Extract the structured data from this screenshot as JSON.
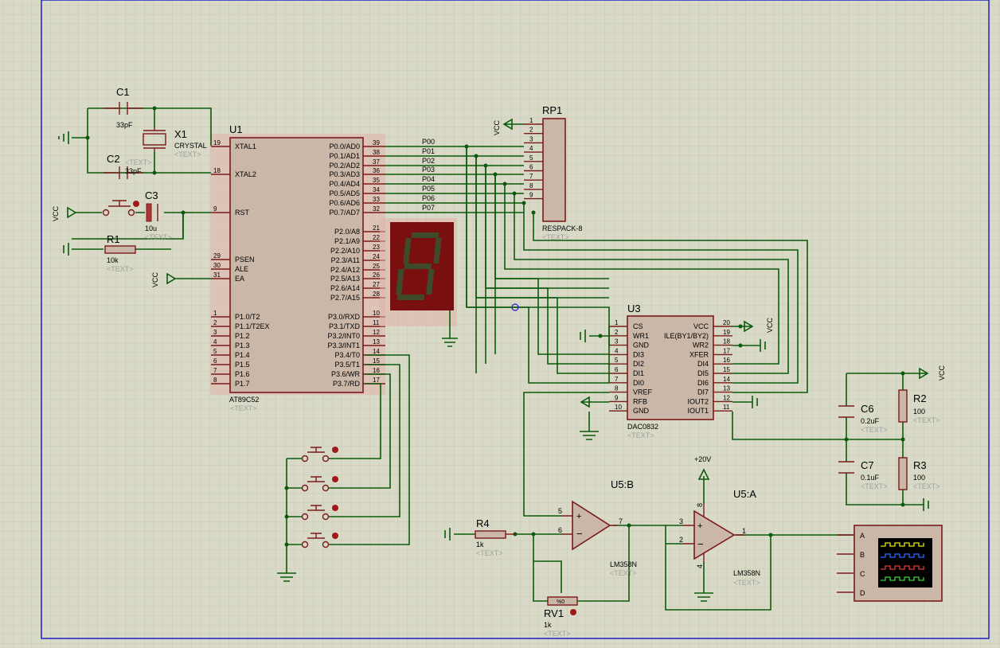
{
  "components": {
    "u1": {
      "ref": "U1",
      "part": "AT89C52",
      "text": "<TEXT>",
      "left_pins": [
        {
          "num": "19",
          "name": "XTAL1"
        },
        {
          "num": "18",
          "name": "XTAL2"
        },
        {
          "num": "9",
          "name": "RST"
        },
        {
          "num": "29",
          "name": "PSEN"
        },
        {
          "num": "30",
          "name": "ALE"
        },
        {
          "num": "31",
          "name": "EA"
        },
        {
          "num": "1",
          "name": "P1.0/T2"
        },
        {
          "num": "2",
          "name": "P1.1/T2EX"
        },
        {
          "num": "3",
          "name": "P1.2"
        },
        {
          "num": "4",
          "name": "P1.3"
        },
        {
          "num": "5",
          "name": "P1.4"
        },
        {
          "num": "6",
          "name": "P1.5"
        },
        {
          "num": "7",
          "name": "P1.6"
        },
        {
          "num": "8",
          "name": "P1.7"
        }
      ],
      "right_pins": [
        {
          "num": "39",
          "name": "P0.0/AD0"
        },
        {
          "num": "38",
          "name": "P0.1/AD1"
        },
        {
          "num": "37",
          "name": "P0.2/AD2"
        },
        {
          "num": "36",
          "name": "P0.3/AD3"
        },
        {
          "num": "35",
          "name": "P0.4/AD4"
        },
        {
          "num": "34",
          "name": "P0.5/AD5"
        },
        {
          "num": "33",
          "name": "P0.6/AD6"
        },
        {
          "num": "32",
          "name": "P0.7/AD7"
        },
        {
          "num": "21",
          "name": "P2.0/A8"
        },
        {
          "num": "22",
          "name": "P2.1/A9"
        },
        {
          "num": "23",
          "name": "P2.2/A10"
        },
        {
          "num": "24",
          "name": "P2.3/A11"
        },
        {
          "num": "25",
          "name": "P2.4/A12"
        },
        {
          "num": "26",
          "name": "P2.5/A13"
        },
        {
          "num": "27",
          "name": "P2.6/A14"
        },
        {
          "num": "28",
          "name": "P2.7/A15"
        },
        {
          "num": "10",
          "name": "P3.0/RXD"
        },
        {
          "num": "11",
          "name": "P3.1/TXD"
        },
        {
          "num": "12",
          "name": "P3.2/INT0"
        },
        {
          "num": "13",
          "name": "P3.3/INT1"
        },
        {
          "num": "14",
          "name": "P3.4/T0"
        },
        {
          "num": "15",
          "name": "P3.5/T1"
        },
        {
          "num": "16",
          "name": "P3.6/WR"
        },
        {
          "num": "17",
          "name": "P3.7/RD"
        }
      ]
    },
    "u3": {
      "ref": "U3",
      "part": "DAC0832",
      "text": "<TEXT>",
      "left_pins": [
        {
          "num": "1",
          "name": "CS"
        },
        {
          "num": "2",
          "name": "WR1"
        },
        {
          "num": "3",
          "name": "GND"
        },
        {
          "num": "4",
          "name": "DI3"
        },
        {
          "num": "5",
          "name": "DI2"
        },
        {
          "num": "6",
          "name": "DI1"
        },
        {
          "num": "7",
          "name": "DI0"
        },
        {
          "num": "8",
          "name": "VREF"
        },
        {
          "num": "9",
          "name": "RFB"
        },
        {
          "num": "10",
          "name": "GND"
        }
      ],
      "right_pins": [
        {
          "num": "20",
          "name": "VCC"
        },
        {
          "num": "19",
          "name": "ILE(BY1/BY2)"
        },
        {
          "num": "18",
          "name": "WR2"
        },
        {
          "num": "17",
          "name": "XFER"
        },
        {
          "num": "16",
          "name": "DI4"
        },
        {
          "num": "15",
          "name": "DI5"
        },
        {
          "num": "14",
          "name": "DI6"
        },
        {
          "num": "13",
          "name": "DI7"
        },
        {
          "num": "12",
          "name": "IOUT2"
        },
        {
          "num": "11",
          "name": "IOUT1"
        }
      ]
    },
    "rp1": {
      "ref": "RP1",
      "part": "RESPACK-8",
      "text": "<TEXT>",
      "pins": [
        "1",
        "2",
        "3",
        "4",
        "5",
        "6",
        "7",
        "8",
        "9"
      ]
    },
    "bus": [
      "P00",
      "P01",
      "P02",
      "P03",
      "P04",
      "P05",
      "P06",
      "P07"
    ],
    "c1": {
      "ref": "C1",
      "value": "33pF"
    },
    "c2": {
      "ref": "C2",
      "value": "33pF",
      "text": "<TEXT>"
    },
    "x1": {
      "ref": "X1",
      "part": "CRYSTAL",
      "text": "<TEXT>"
    },
    "c3": {
      "ref": "C3",
      "value": "10u",
      "text": "<TEXT>"
    },
    "r1": {
      "ref": "R1",
      "value": "10k",
      "text": "<TEXT>"
    },
    "r4": {
      "ref": "R4",
      "value": "1k",
      "text": "<TEXT>"
    },
    "rv1": {
      "ref": "RV1",
      "value": "1k",
      "text": "<TEXT>",
      "pot": "%0"
    },
    "c6": {
      "ref": "C6",
      "value": "0.2uF",
      "text": "<TEXT>"
    },
    "c7": {
      "ref": "C7",
      "value": "0.1uF",
      "text": "<TEXT>"
    },
    "r2": {
      "ref": "R2",
      "value": "100",
      "text": "<TEXT>"
    },
    "r3": {
      "ref": "R3",
      "value": "100",
      "text": "<TEXT>"
    },
    "u5b": {
      "ref": "U5:B",
      "part": "LM358N",
      "text": "<TEXT>",
      "pins": {
        "plus": "5",
        "minus": "6",
        "out": "7"
      }
    },
    "u5a": {
      "ref": "U5:A",
      "part": "LM358N",
      "text": "<TEXT>",
      "pins": {
        "plus": "3",
        "minus": "2",
        "out": "1",
        "vplus": "8",
        "vminus": "4"
      }
    },
    "supply": "+20V",
    "vcc": "VCC",
    "scope": {
      "channels": [
        "A",
        "B",
        "C",
        "D"
      ]
    }
  },
  "colors": {
    "grid_bg": "#d9d9c7",
    "grid_line": "#c3c3ae",
    "wire": "#0b5a0b",
    "component": "#7a1a1a",
    "body_fill": "#cbb7a8",
    "led_bg": "#7a0f0f",
    "led_seg": "#3f4a2a",
    "sheet_border": "#1f1fc8"
  }
}
